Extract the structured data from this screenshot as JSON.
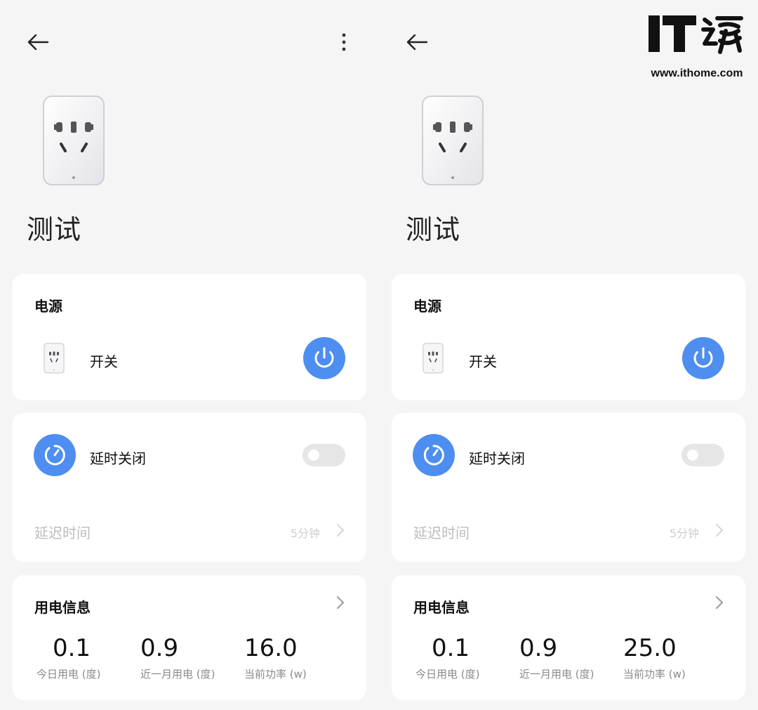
{
  "screens": [
    {
      "device_name": "测试",
      "power_card": {
        "title": "电源",
        "switch_label": "开关"
      },
      "delay_card": {
        "label": "延时关闭",
        "delay_time_label": "延迟时间",
        "delay_time_value": "5分钟",
        "enabled": false
      },
      "usage_card": {
        "title": "用电信息",
        "stats": [
          {
            "value": "0.1",
            "label": "今日用电 (度)"
          },
          {
            "value": "0.9",
            "label": "近一月用电 (度)"
          },
          {
            "value": "16.0",
            "label": "当前功率 (w)"
          }
        ]
      }
    },
    {
      "device_name": "测试",
      "power_card": {
        "title": "电源",
        "switch_label": "开关"
      },
      "delay_card": {
        "label": "延时关闭",
        "delay_time_label": "延迟时间",
        "delay_time_value": "5分钟",
        "enabled": false
      },
      "usage_card": {
        "title": "用电信息",
        "stats": [
          {
            "value": "0.1",
            "label": "今日用电 (度)"
          },
          {
            "value": "0.9",
            "label": "近一月用电 (度)"
          },
          {
            "value": "25.0",
            "label": "当前功率 (w)"
          }
        ]
      }
    }
  ],
  "watermark": {
    "logo_text": "IT之家",
    "url": "www.ithome.com"
  },
  "icons": {
    "back": "back-arrow-icon",
    "more": "more-vertical-icon",
    "power": "power-icon",
    "timer": "timer-icon",
    "chevron": "chevron-right-icon"
  },
  "colors": {
    "accent": "#4d8ef0",
    "background": "#f5f5f5",
    "card": "#ffffff",
    "toggle_off": "#e6e6e6"
  }
}
